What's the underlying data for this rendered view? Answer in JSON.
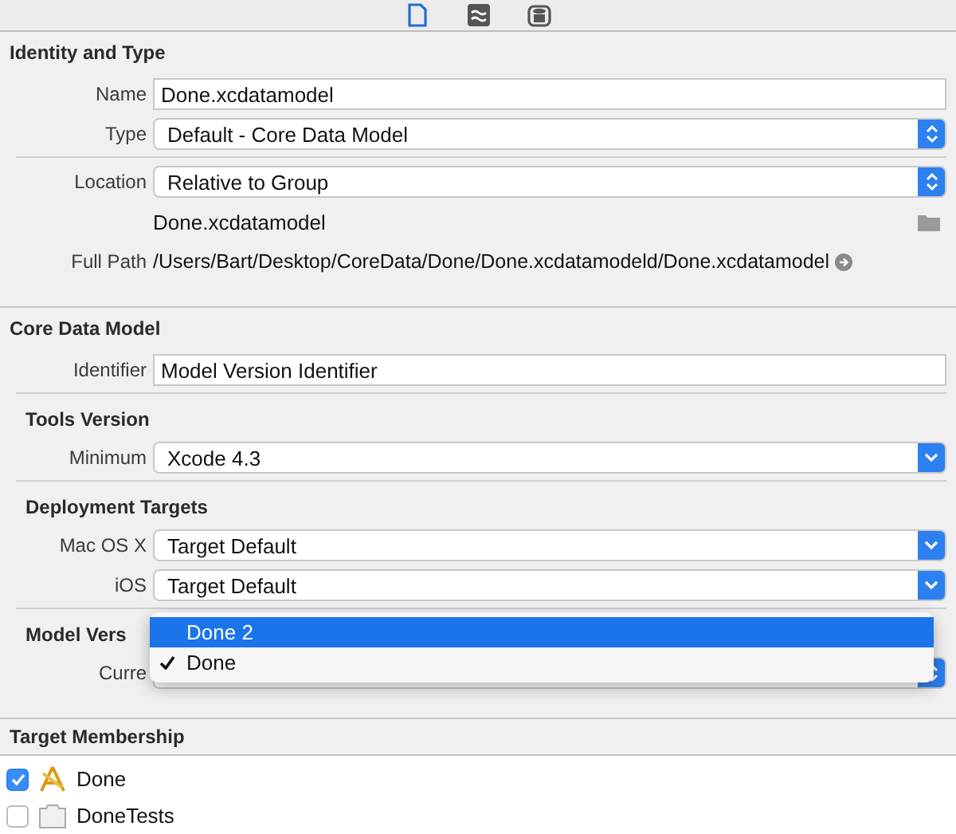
{
  "toolbar": [
    {
      "kind": "file",
      "selected": true
    },
    {
      "kind": "quick-help",
      "selected": false
    },
    {
      "kind": "model",
      "selected": false
    }
  ],
  "sections": [
    {
      "title": "Identity and Type",
      "groups": [
        {
          "rows": [
            {
              "kind": "field",
              "label": "Name",
              "value": "Done.xcdatamodel"
            },
            {
              "kind": "stepper",
              "label": "Type",
              "value": "Default - Core Data Model"
            }
          ]
        },
        {
          "rows": [
            {
              "kind": "stepper",
              "label": "Location",
              "value": "Relative to Group"
            },
            {
              "kind": "file",
              "value": "Done.xcdatamodel"
            },
            {
              "kind": "path",
              "label": "Full Path",
              "value": "/Users/Bart/Desktop/CoreData/Done/Done.xcdatamodeld/Done.xcdatamodel"
            }
          ]
        }
      ]
    },
    {
      "title": "Core Data Model",
      "groups": [
        {
          "rows": [
            {
              "kind": "field",
              "label": "Identifier",
              "value": "Model Version Identifier"
            }
          ]
        },
        {
          "title": "Tools Version",
          "rows": [
            {
              "kind": "dropdown",
              "label": "Minimum",
              "value": "Xcode 4.3"
            }
          ]
        },
        {
          "title": "Deployment Targets",
          "rows": [
            {
              "kind": "dropdown",
              "label": "Mac OS X",
              "value": "Target Default"
            },
            {
              "kind": "dropdown",
              "label": "iOS",
              "value": "Target Default"
            }
          ]
        },
        {
          "title": "Model Vers",
          "rows": [
            {
              "kind": "stepper",
              "label": "Curre",
              "menu": [
                {
                  "label": "Done 2",
                  "selected": true,
                  "checked": false
                },
                {
                  "label": "Done",
                  "selected": false,
                  "checked": true
                }
              ]
            }
          ]
        }
      ]
    }
  ],
  "target_membership": {
    "title": "Target Membership",
    "targets": [
      {
        "name": "Done",
        "checked": true,
        "kind": "app"
      },
      {
        "name": "DoneTests",
        "checked": false,
        "kind": "bundle"
      }
    ]
  }
}
